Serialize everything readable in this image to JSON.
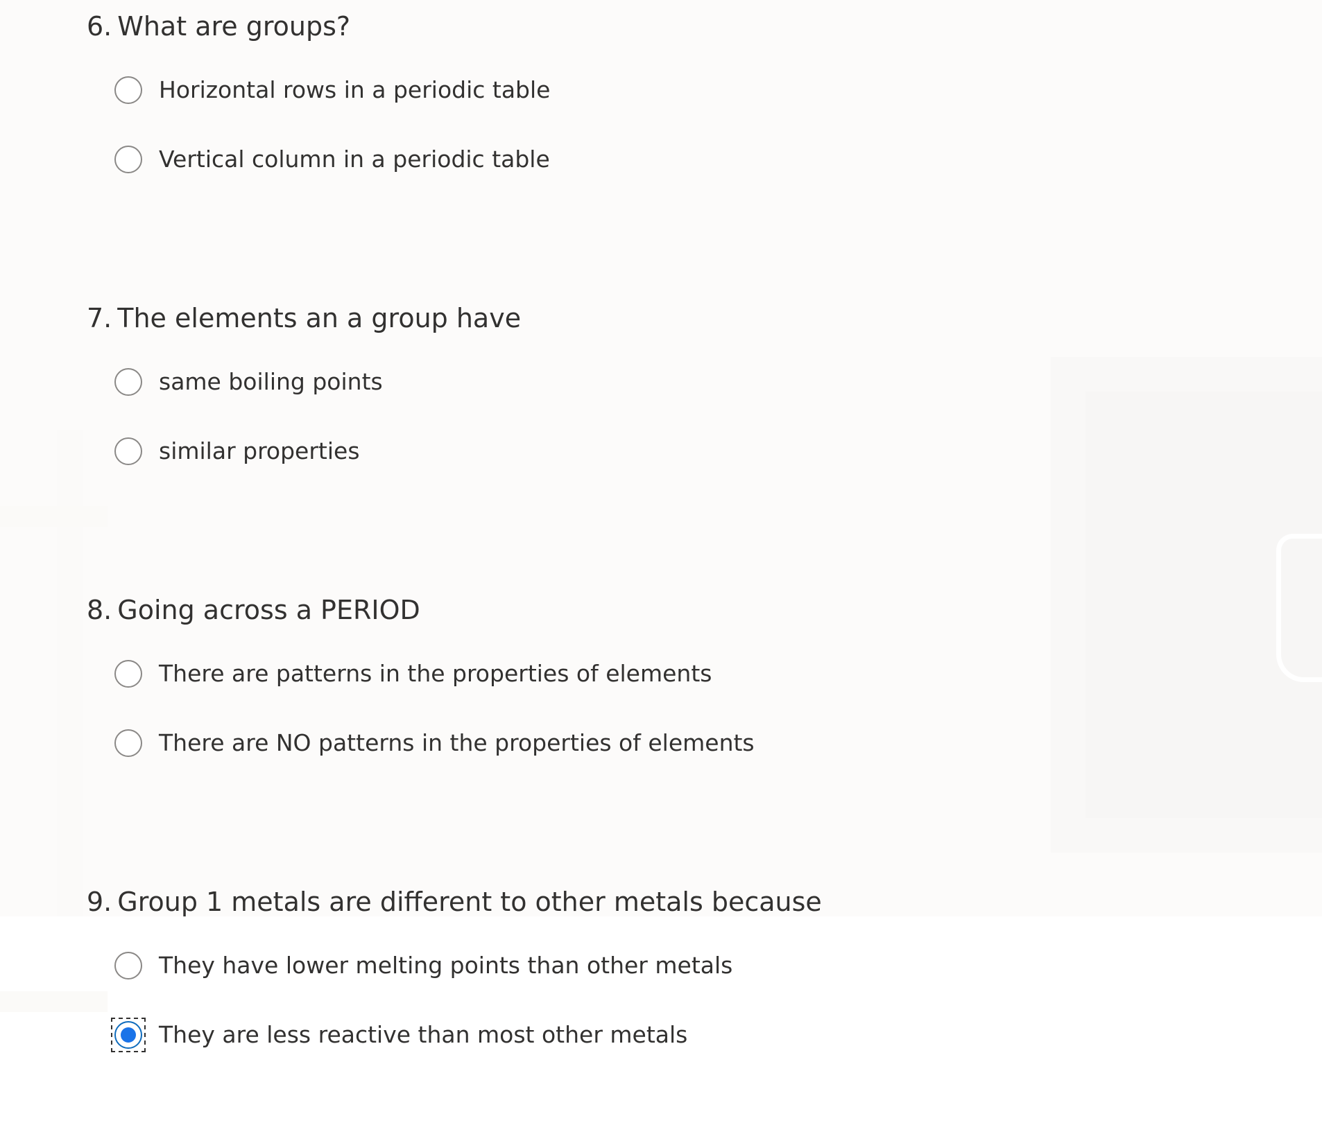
{
  "questions": [
    {
      "number": "6.",
      "title": "What are groups?",
      "options": [
        {
          "label": "Horizontal rows in a periodic table",
          "selected": false
        },
        {
          "label": "Vertical column in a periodic table",
          "selected": false
        }
      ]
    },
    {
      "number": "7.",
      "title": "The elements an a group have",
      "options": [
        {
          "label": "same boiling points",
          "selected": false
        },
        {
          "label": "similar properties",
          "selected": false
        }
      ]
    },
    {
      "number": "8.",
      "title": "Going across a PERIOD",
      "options": [
        {
          "label": "There are patterns in the properties of elements",
          "selected": false
        },
        {
          "label": "There are NO patterns in the properties of elements",
          "selected": false
        }
      ]
    },
    {
      "number": "9.",
      "title": "Group 1 metals are different to other metals because",
      "options": [
        {
          "label": "They have lower melting points than other metals",
          "selected": false
        },
        {
          "label": "They are less reactive than most other metals",
          "selected": true
        }
      ]
    }
  ],
  "colors": {
    "text": "#323130",
    "radio_border": "#8a8886",
    "radio_selected": "#1a73e8",
    "background": "#fcfbfa"
  }
}
